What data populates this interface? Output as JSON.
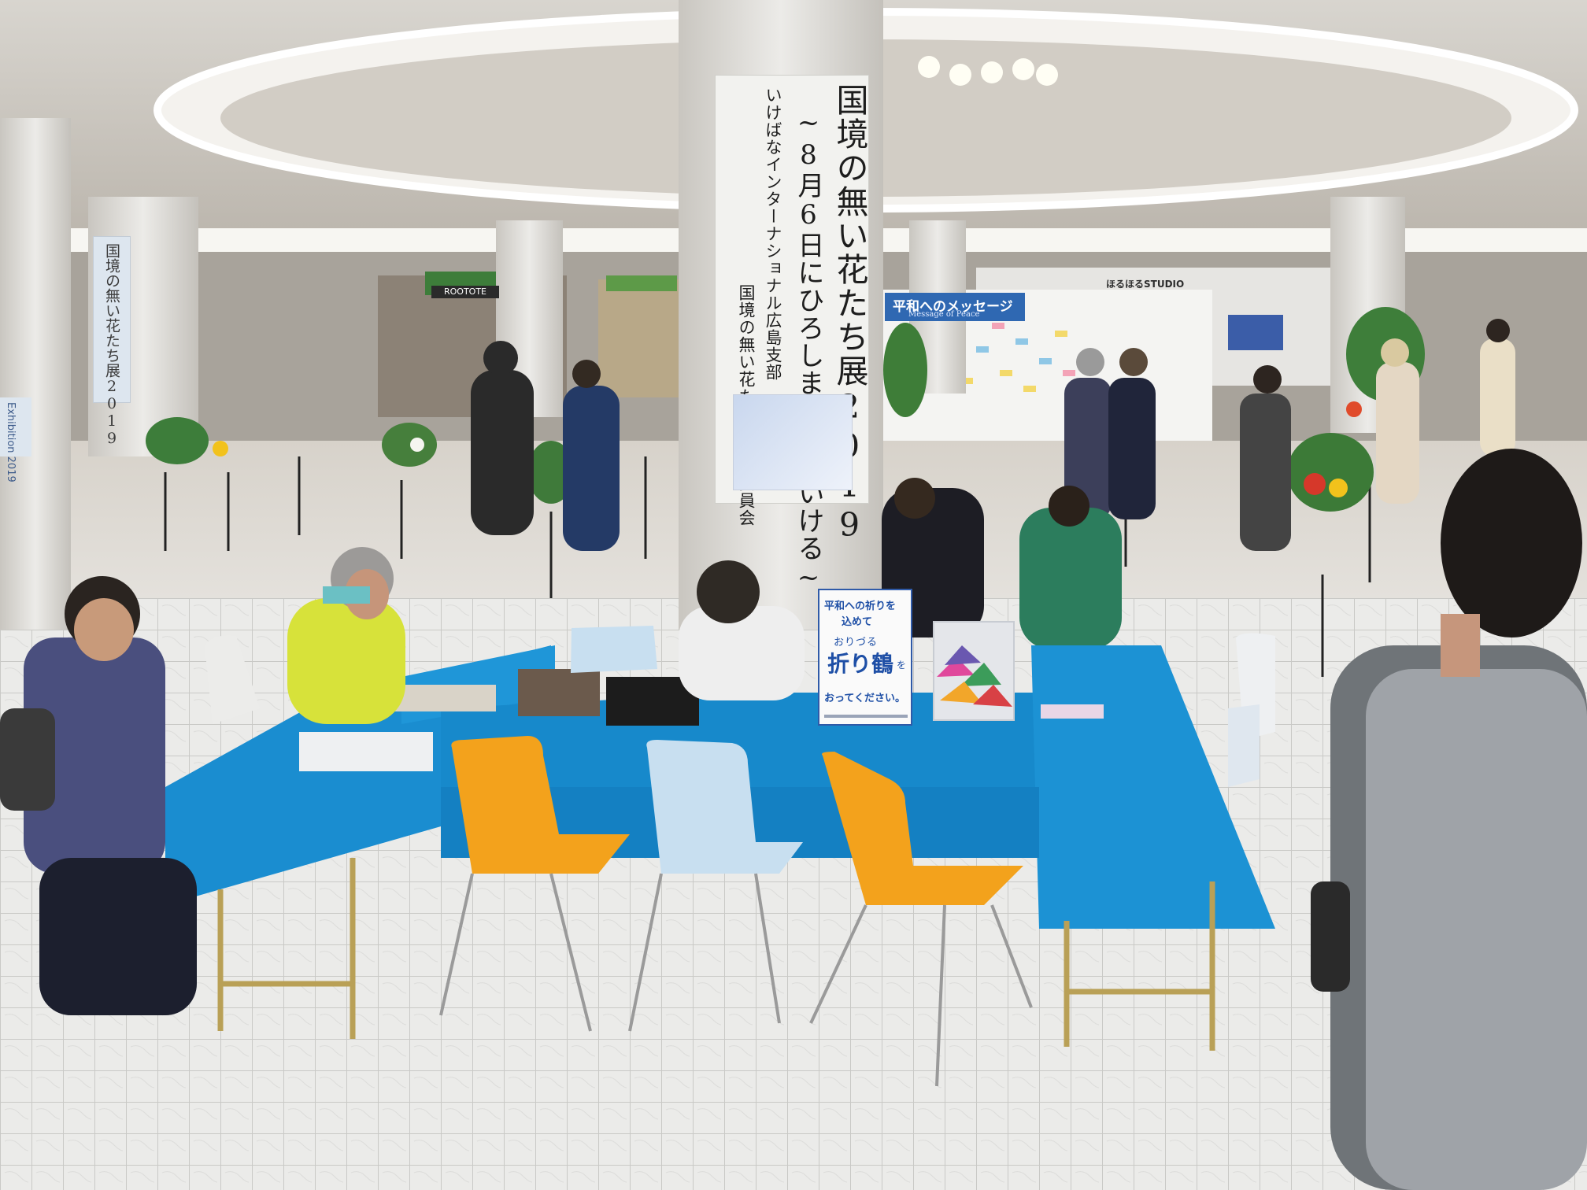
{
  "pillar_banner": {
    "title": "国境の無い花たち展2019",
    "subtitle": "~8月6日にひろしまで花をいける~",
    "organizer": "いけばなインターナショナル広島支部",
    "committee": "国境の無い花たち展実行委員会"
  },
  "left_pillar_banner": {
    "text": "国境の無い花たち展2019",
    "sub_text": "Exhibition 2019"
  },
  "message_board": {
    "title": "平和へのメッセージ",
    "subtitle": "Message of Peace"
  },
  "studio_sign": "ほるほるSTUDIO",
  "shop_sign": "ROOTOTE",
  "origami_sign": {
    "line1": "平和への祈りを",
    "line2": "込めて",
    "ruby": "おりづる",
    "main": "折り鶴",
    "particle": "を",
    "line4": "おってください。"
  },
  "colors": {
    "tablecloth": "#1b8fd0",
    "chair_orange": "#f3a21c",
    "chair_light_blue": "#c8dff0",
    "floor_tile": "#e9e9e7",
    "sign_blue": "#1e4fa6",
    "message_header": "#2f68b2"
  }
}
